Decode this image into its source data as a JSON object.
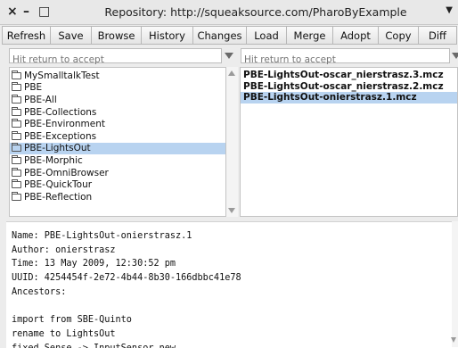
{
  "window": {
    "title": "Repository: http://squeaksource.com/PharoByExample",
    "controls": [
      "×",
      "–",
      "□"
    ]
  },
  "toolbar": [
    "Refresh",
    "Save",
    "Browse",
    "History",
    "Changes",
    "Load",
    "Merge",
    "Adopt",
    "Copy",
    "Diff"
  ],
  "left_filter": {
    "placeholder": "Hit return to accept"
  },
  "right_filter": {
    "placeholder": "Hit return to accept"
  },
  "packages": [
    {
      "label": "MySmalltalkTest",
      "selected": false
    },
    {
      "label": "PBE",
      "selected": false
    },
    {
      "label": "PBE-All",
      "selected": false
    },
    {
      "label": "PBE-Collections",
      "selected": false
    },
    {
      "label": "PBE-Environment",
      "selected": false
    },
    {
      "label": "PBE-Exceptions",
      "selected": false
    },
    {
      "label": "PBE-LightsOut",
      "selected": true
    },
    {
      "label": "PBE-Morphic",
      "selected": false
    },
    {
      "label": "PBE-OmniBrowser",
      "selected": false
    },
    {
      "label": "PBE-QuickTour",
      "selected": false
    },
    {
      "label": "PBE-Reflection",
      "selected": false
    }
  ],
  "versions": [
    {
      "label": "PBE-LightsOut-oscar_nierstrasz.3.mcz",
      "selected": false
    },
    {
      "label": "PBE-LightsOut-oscar_nierstrasz.2.mcz",
      "selected": false
    },
    {
      "label": "PBE-LightsOut-onierstrasz.1.mcz",
      "selected": true
    }
  ],
  "info_lines": [
    "Name: PBE-LightsOut-onierstrasz.1",
    "Author: onierstrasz",
    "Time: 13 May 2009, 12:30:52 pm",
    "UUID: 4254454f-2e72-4b44-8b30-166dbbc41e78",
    "Ancestors:",
    "",
    "import from SBE-Quinto",
    "rename to LightsOut",
    "fixed Sense -> InputSensor new"
  ]
}
